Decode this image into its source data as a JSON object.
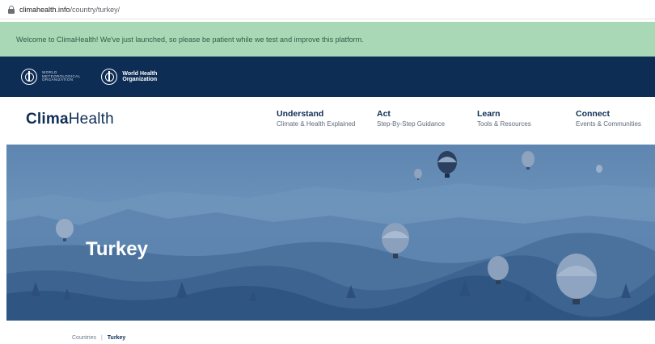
{
  "browser": {
    "url_host": "climahealth.info",
    "url_path": "/country/turkey/"
  },
  "notice": {
    "text": "Welcome to ClimaHealth! We've just launched, so please be patient while we test and improve this platform."
  },
  "orgs": {
    "wmo": [
      "WORLD",
      "METEOROLOGICAL",
      "ORGANIZATION"
    ],
    "who": [
      "World Health",
      "Organization"
    ]
  },
  "header": {
    "logo_bold": "Clima",
    "logo_regular": "Health",
    "nav": [
      {
        "title": "Understand",
        "sub": "Climate & Health Explained"
      },
      {
        "title": "Act",
        "sub": "Step-By-Step Guidance"
      },
      {
        "title": "Learn",
        "sub": "Tools & Resources"
      },
      {
        "title": "Connect",
        "sub": "Events & Communities"
      }
    ]
  },
  "hero": {
    "title": "Turkey"
  },
  "breadcrumb": {
    "parent": "Countries",
    "separator": "|",
    "current": "Turkey"
  },
  "colors": {
    "navy": "#0e2d55",
    "notice_green": "#a8d8b6",
    "hero_blue": "#5e86b0"
  },
  "icons": [
    "lock-icon",
    "wmo-emblem-icon",
    "who-emblem-icon"
  ]
}
